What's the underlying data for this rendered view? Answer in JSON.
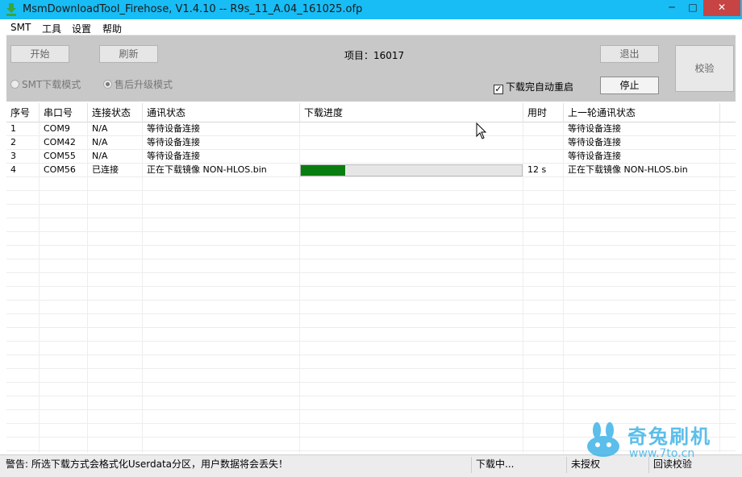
{
  "window": {
    "title": "MsmDownloadTool_Firehose, V1.4.10 -- R9s_11_A.04_161025.ofp",
    "app_icon": "download-arrow-icon",
    "controls": {
      "minimize": "─",
      "maximize": "□",
      "close": "✕"
    }
  },
  "menu": [
    "SMT",
    "工具",
    "设置",
    "帮助"
  ],
  "toolbar": {
    "start_label": "开始",
    "refresh_label": "刷新",
    "project_label": "项目：",
    "project_value": "16017",
    "exit_label": "退出",
    "stop_label": "停止",
    "verify_label": "校验",
    "mode_smt_label": "SMT下载模式",
    "mode_aftersale_label": "售后升级模式",
    "mode_selected": "售后升级模式",
    "auto_reboot_label": "下载完自动重启",
    "auto_reboot_checked": true
  },
  "table": {
    "columns": [
      "序号",
      "串口号",
      "连接状态",
      "通讯状态",
      "下载进度",
      "用时",
      "上一轮通讯状态"
    ],
    "rows": [
      {
        "index": "1",
        "port": "COM9",
        "connection": "N/A",
        "comm_status": "等待设备连接",
        "progress": null,
        "time": "",
        "last_status": "等待设备连接"
      },
      {
        "index": "2",
        "port": "COM42",
        "connection": "N/A",
        "comm_status": "等待设备连接",
        "progress": null,
        "time": "",
        "last_status": "等待设备连接"
      },
      {
        "index": "3",
        "port": "COM55",
        "connection": "N/A",
        "comm_status": "等待设备连接",
        "progress": null,
        "time": "",
        "last_status": "等待设备连接"
      },
      {
        "index": "4",
        "port": "COM56",
        "connection": "已连接",
        "comm_status": "正在下载镜像 NON-HLOS.bin",
        "progress": 0.2,
        "time": "12 s",
        "last_status": "正在下载镜像 NON-HLOS.bin"
      }
    ],
    "progress_color": "#0a7d10"
  },
  "statusbar": {
    "warning": "警告: 所选下载方式会格式化Userdata分区，用户数据将会丢失！",
    "download_state": "下载中...",
    "auth_state": "未授权",
    "verify_state": "回读校验"
  },
  "watermark": {
    "brand": "奇兔刷机",
    "url": "www.7to.cn"
  },
  "colors": {
    "titlebar": "#18bdf5",
    "close_button": "#c74444",
    "watermark": "#3fb3e8"
  }
}
